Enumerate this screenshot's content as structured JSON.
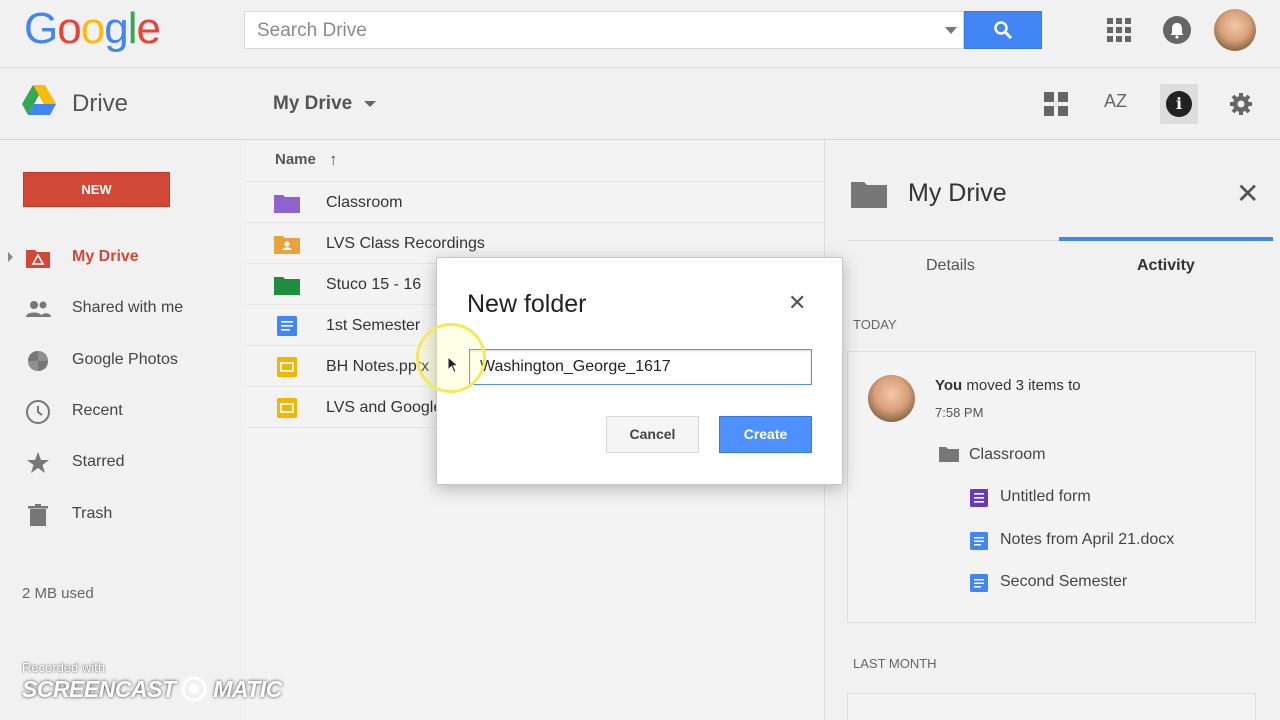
{
  "header": {
    "logo_letters": [
      "G",
      "o",
      "o",
      "g",
      "l",
      "e"
    ],
    "logo_colors": [
      "#4285f4",
      "#ea4335",
      "#fbbc05",
      "#4285f4",
      "#34a853",
      "#ea4335"
    ],
    "search_placeholder": "Search Drive"
  },
  "subbar": {
    "app_name": "Drive",
    "location_title": "My Drive",
    "sort_label": "AZ"
  },
  "sidebar": {
    "new_label": "NEW",
    "items": [
      {
        "label": "My Drive",
        "icon": "my-drive-icon"
      },
      {
        "label": "Shared with me",
        "icon": "shared-icon"
      },
      {
        "label": "Google Photos",
        "icon": "photos-icon"
      },
      {
        "label": "Recent",
        "icon": "clock-icon"
      },
      {
        "label": "Starred",
        "icon": "star-icon"
      },
      {
        "label": "Trash",
        "icon": "trash-icon"
      }
    ],
    "storage": "2 MB used"
  },
  "filelist": {
    "column_name": "Name",
    "files": [
      {
        "name": "Classroom",
        "type": "folder",
        "color": "#8e63ce"
      },
      {
        "name": "LVS Class Recordings",
        "type": "shared-folder",
        "color": "#e8a33d"
      },
      {
        "name": "Stuco 15 - 16",
        "type": "folder",
        "color": "#1e8e3e"
      },
      {
        "name": "1st Semester",
        "type": "doc",
        "color": "#4285f4"
      },
      {
        "name": "BH Notes.pptx",
        "type": "slides",
        "color": "#f4b400"
      },
      {
        "name": "LVS and Google",
        "type": "slides",
        "color": "#f4b400"
      }
    ]
  },
  "details_panel": {
    "title": "My Drive",
    "tabs": [
      "Details",
      "Activity"
    ],
    "active_tab": "Activity",
    "today_label": "TODAY",
    "activity": {
      "actor": "You",
      "action": " moved 3 items to",
      "time": "7:58 PM",
      "destination": "Classroom",
      "items": [
        {
          "name": "Untitled form",
          "icon": "form-icon",
          "color": "#673ab7"
        },
        {
          "name": "Notes from April 21.docx",
          "icon": "doc-icon",
          "color": "#4285f4"
        },
        {
          "name": "Second Semester",
          "icon": "doc-icon",
          "color": "#4285f4"
        }
      ]
    },
    "last_month_label": "LAST MONTH"
  },
  "dialog": {
    "title": "New folder",
    "close_glyph": "✕",
    "input_value": "Washington_George_1617",
    "cancel_label": "Cancel",
    "create_label": "Create"
  },
  "watermark": {
    "line1": "Recorded with",
    "line2": "SCREENCAST",
    "line3": "MATIC"
  }
}
